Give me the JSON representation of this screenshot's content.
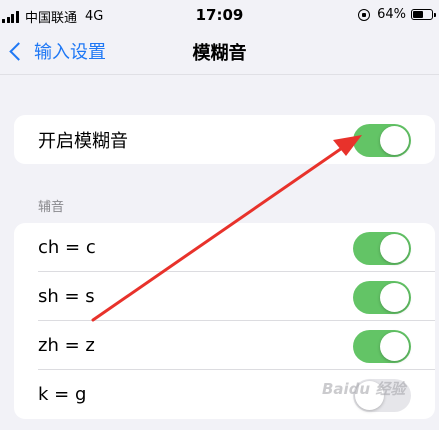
{
  "status_bar": {
    "carrier": "中国联通",
    "network": "4G",
    "time": "17:09",
    "battery": "64%",
    "battery_level": 0.64,
    "icons": [
      "signal-icon",
      "rotation-lock-icon",
      "battery-icon"
    ]
  },
  "nav": {
    "back_label": "输入设置",
    "title": "模糊音"
  },
  "main_toggle": {
    "label": "开启模糊音",
    "on": true
  },
  "consonants": {
    "header": "辅音",
    "items": [
      {
        "label": "ch = c",
        "on": true
      },
      {
        "label": "sh = s",
        "on": true
      },
      {
        "label": "zh = z",
        "on": true
      },
      {
        "label": "k = g",
        "on": false
      }
    ]
  },
  "watermark": "Baidu 经验",
  "colors": {
    "accent": "#1f78f5",
    "toggle_on": "#63c466",
    "annotation_arrow": "#e8322b",
    "background": "#f2f2f7"
  }
}
